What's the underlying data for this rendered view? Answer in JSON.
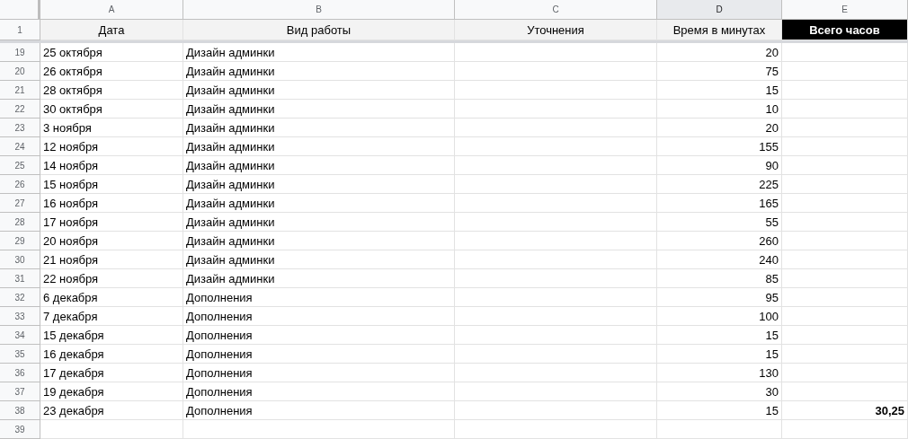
{
  "columns": [
    {
      "letter": "A",
      "selected": false
    },
    {
      "letter": "B",
      "selected": false
    },
    {
      "letter": "C",
      "selected": false
    },
    {
      "letter": "D",
      "selected": true
    },
    {
      "letter": "E",
      "selected": false
    }
  ],
  "header_row": {
    "number": "1",
    "cells": [
      {
        "text": "Дата",
        "highlighted": false
      },
      {
        "text": "Вид работы",
        "highlighted": false
      },
      {
        "text": "Уточнения",
        "highlighted": false
      },
      {
        "text": "Время в минутах",
        "highlighted": false
      },
      {
        "text": "Всего часов",
        "highlighted": true
      }
    ]
  },
  "rows": [
    {
      "number": "19",
      "date": "25 октября",
      "work": "Дизайн админки",
      "minutes": "20"
    },
    {
      "number": "20",
      "date": "26 октября",
      "work": "Дизайн админки",
      "minutes": "75"
    },
    {
      "number": "21",
      "date": "28 октября",
      "work": "Дизайн админки",
      "minutes": "15"
    },
    {
      "number": "22",
      "date": "30 октября",
      "work": "Дизайн админки",
      "minutes": "10"
    },
    {
      "number": "23",
      "date": "3 ноября",
      "work": "Дизайн админки",
      "minutes": "20"
    },
    {
      "number": "24",
      "date": "12 ноября",
      "work": "Дизайн админки",
      "minutes": "155"
    },
    {
      "number": "25",
      "date": "14 ноября",
      "work": "Дизайн админки",
      "minutes": "90"
    },
    {
      "number": "26",
      "date": "15 ноября",
      "work": "Дизайн админки",
      "minutes": "225"
    },
    {
      "number": "27",
      "date": "16 ноября",
      "work": "Дизайн админки",
      "minutes": "165"
    },
    {
      "number": "28",
      "date": "17 ноября",
      "work": "Дизайн админки",
      "minutes": "55"
    },
    {
      "number": "29",
      "date": "20 ноября",
      "work": "Дизайн админки",
      "minutes": "260"
    },
    {
      "number": "30",
      "date": "21 ноября",
      "work": "Дизайн админки",
      "minutes": "240"
    },
    {
      "number": "31",
      "date": "22 ноября",
      "work": "Дизайн админки",
      "minutes": "85"
    },
    {
      "number": "32",
      "date": "6 декабря",
      "work": "Дополнения",
      "minutes": "95"
    },
    {
      "number": "33",
      "date": "7 декабря",
      "work": "Дополнения",
      "minutes": "100"
    },
    {
      "number": "34",
      "date": "15 декабря",
      "work": "Дополнения",
      "minutes": "15"
    },
    {
      "number": "35",
      "date": "16 декабря",
      "work": "Дополнения",
      "minutes": "15"
    },
    {
      "number": "36",
      "date": "17 декабря",
      "work": "Дополнения",
      "minutes": "130"
    },
    {
      "number": "37",
      "date": "19 декабря",
      "work": "Дополнения",
      "minutes": "30"
    },
    {
      "number": "38",
      "date": "23 декабря",
      "work": "Дополнения",
      "minutes": "15",
      "total": "30,25"
    },
    {
      "number": "39"
    }
  ]
}
